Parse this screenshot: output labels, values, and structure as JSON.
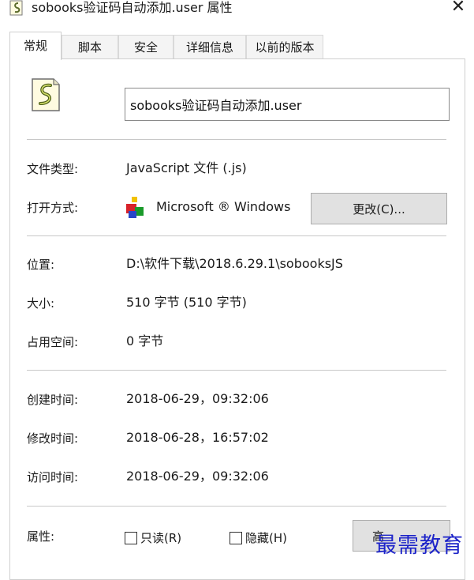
{
  "window": {
    "title": "sobooks验证码自动添加.user 属性",
    "close_symbol": "✕"
  },
  "tabs": [
    {
      "label": "常规",
      "active": true
    },
    {
      "label": "脚本",
      "active": false
    },
    {
      "label": "安全",
      "active": false
    },
    {
      "label": "详细信息",
      "active": false
    },
    {
      "label": "以前的版本",
      "active": false
    }
  ],
  "general": {
    "file_icon": "javascript-file-icon",
    "file_name": "sobooks验证码自动添加.user",
    "type_label": "文件类型:",
    "type_value": "JavaScript 文件 (.js)",
    "opens_with_label": "打开方式:",
    "opens_with_icon": "windows-script-host-icon",
    "opens_with_value": "Microsoft ® Windows",
    "change_button": "更改(C)...",
    "location_label": "位置:",
    "location_value": "D:\\软件下载\\2018.6.29.1\\sobooksJS",
    "size_label": "大小:",
    "size_value": "510 字节 (510 字节)",
    "size_on_disk_label": "占用空间:",
    "size_on_disk_value": "0 字节",
    "created_label": "创建时间:",
    "created_value": "2018-06-29，09:32:06",
    "modified_label": "修改时间:",
    "modified_value": "2018-06-28，16:57:02",
    "accessed_label": "访问时间:",
    "accessed_value": "2018-06-29，09:32:06",
    "attributes_label": "属性:",
    "readonly_label": "只读(R)",
    "hidden_label": "隐藏(H)",
    "advanced_button": "高",
    "readonly_checked": false,
    "hidden_checked": false
  },
  "watermark": "最需教育",
  "colors": {
    "watermark": "#1d24c9",
    "button_bg": "#e1e1e1",
    "border": "#cfcfcf"
  }
}
